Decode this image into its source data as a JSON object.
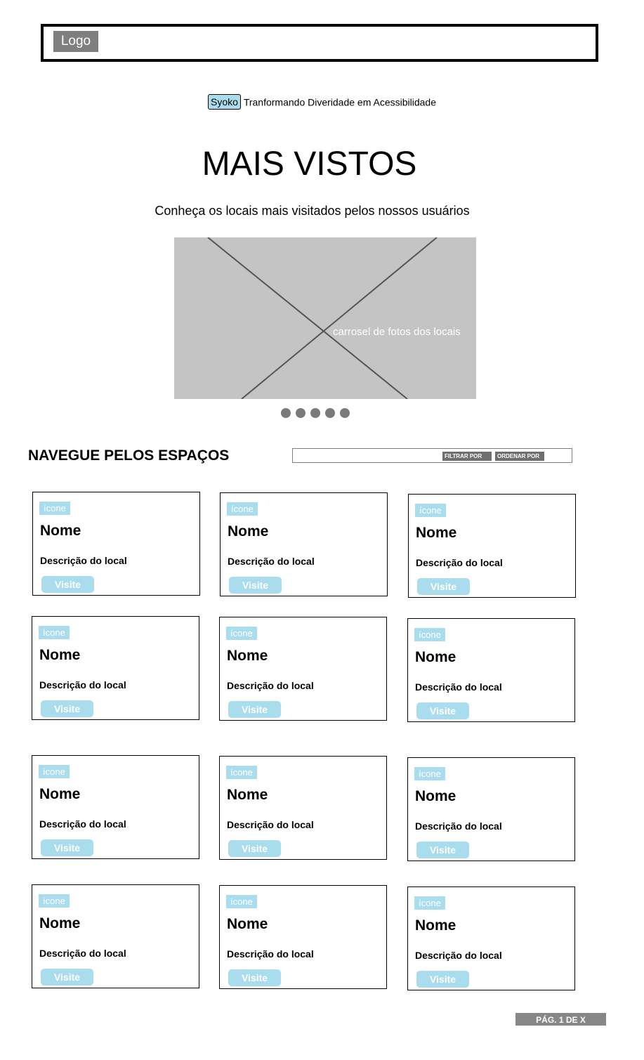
{
  "header": {
    "logo_label": "Logo"
  },
  "tagline": {
    "brand": "Syoko",
    "text": "Tranformando Diveridade em Acessibilidade"
  },
  "hero": {
    "title": "MAIS VISTOS",
    "subtitle": "Conheça os locais mais visitados pelos nossos usuários",
    "carousel_caption": "carrosel de fotos dos locais",
    "dots_count": 5
  },
  "browse": {
    "title": "NAVEGUE PELOS ESPAÇOS",
    "filter_label": "FILTRAR POR",
    "order_label": "ORDENAR POR"
  },
  "cards": [
    {
      "icon": "ícone",
      "name": "Nome",
      "description": "Descrição do local",
      "button": "Visite"
    },
    {
      "icon": "ícone",
      "name": "Nome",
      "description": "Descrição do local",
      "button": "Visite"
    },
    {
      "icon": "ícone",
      "name": "Nome",
      "description": "Descrição do local",
      "button": "Visite"
    },
    {
      "icon": "ícone",
      "name": "Nome",
      "description": "Descrição do local",
      "button": "Visite"
    },
    {
      "icon": "ícone",
      "name": "Nome",
      "description": "Descrição do local",
      "button": "Visite"
    },
    {
      "icon": "ícone",
      "name": "Nome",
      "description": "Descrição do local",
      "button": "Visite"
    },
    {
      "icon": "ícone",
      "name": "Nome",
      "description": "Descrição do local",
      "button": "Visite"
    },
    {
      "icon": "ícone",
      "name": "Nome",
      "description": "Descrição do local",
      "button": "Visite"
    },
    {
      "icon": "ícone",
      "name": "Nome",
      "description": "Descrição do local",
      "button": "Visite"
    },
    {
      "icon": "ícone",
      "name": "Nome",
      "description": "Descrição do local",
      "button": "Visite"
    },
    {
      "icon": "ícone",
      "name": "Nome",
      "description": "Descrição do local",
      "button": "Visite"
    },
    {
      "icon": "ícone",
      "name": "Nome",
      "description": "Descrição do local",
      "button": "Visite"
    }
  ],
  "pagination": {
    "label": "PÁG. 1 DE X"
  },
  "colors": {
    "accent": "#a9dced",
    "placeholder": "#c4c4c4",
    "gray": "#7f7f7f"
  }
}
